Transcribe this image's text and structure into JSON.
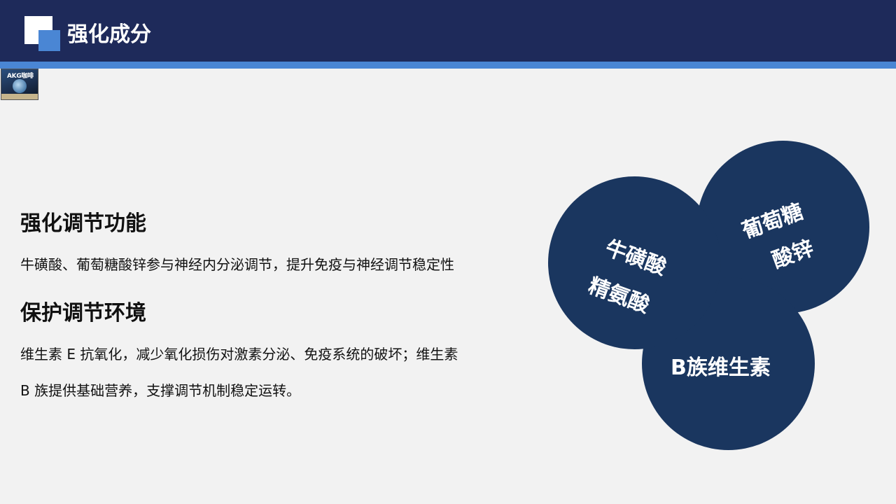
{
  "header": {
    "title": "强化成分"
  },
  "product_image": {
    "brand_text": "AKG咖啡"
  },
  "sections": [
    {
      "heading": "强化调节功能",
      "lines": [
        "牛磺酸、葡萄糖酸锌参与神经内分泌调节，提升免疫与神经调节稳定性"
      ]
    },
    {
      "heading": "保护调节环境",
      "lines": [
        "维生素 E 抗氧化，减少氧化损伤对激素分泌、免疫系统的破坏；维生素",
        "B 族提供基础营养，支撑调节机制稳定运转。"
      ]
    }
  ],
  "bubbles": {
    "left": {
      "line1": "牛磺酸",
      "line2": "精氨酸"
    },
    "right": {
      "line1": "葡萄糖",
      "line2": "酸锌"
    },
    "bottom": {
      "line1": "B族维生素"
    }
  },
  "colors": {
    "header_bg": "#1e2a5a",
    "accent": "#4a86d4",
    "bubble": "#1a365f",
    "page_bg": "#f2f2f2"
  }
}
